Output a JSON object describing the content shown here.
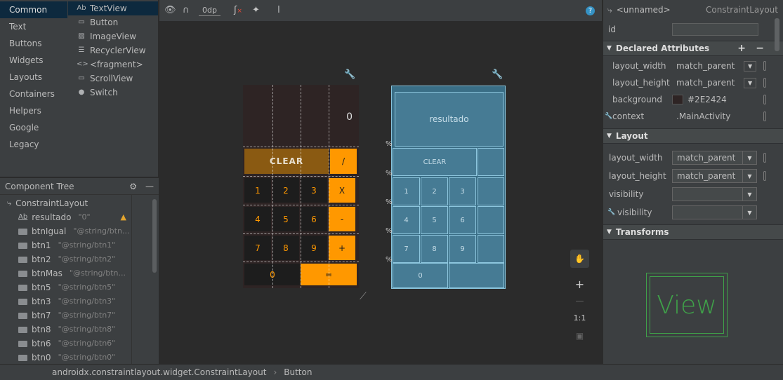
{
  "palette": {
    "categories": [
      "Common",
      "Text",
      "Buttons",
      "Widgets",
      "Layouts",
      "Containers",
      "Helpers",
      "Google",
      "Legacy"
    ],
    "selected_category": "Common",
    "widgets": [
      {
        "icon": "Ab",
        "label": "TextView"
      },
      {
        "icon": "▭",
        "label": "Button"
      },
      {
        "icon": "▨",
        "label": "ImageView"
      },
      {
        "icon": "☰",
        "label": "RecyclerView"
      },
      {
        "icon": "<>",
        "label": "<fragment>"
      },
      {
        "icon": "▭",
        "label": "ScrollView"
      },
      {
        "icon": "●",
        "label": "Switch"
      }
    ]
  },
  "component_tree": {
    "title": "Component Tree",
    "root": "ConstraintLayout",
    "nodes": [
      {
        "name": "resultado",
        "value": "\"0\"",
        "warning": true,
        "text_icon": true
      },
      {
        "name": "btnIgual",
        "value": "\"@string/btn..."
      },
      {
        "name": "btn1",
        "value": "\"@string/btn1\""
      },
      {
        "name": "btn2",
        "value": "\"@string/btn2\""
      },
      {
        "name": "btnMas",
        "value": "\"@string/btn..."
      },
      {
        "name": "btn5",
        "value": "\"@string/btn5\""
      },
      {
        "name": "btn3",
        "value": "\"@string/btn3\""
      },
      {
        "name": "btn7",
        "value": "\"@string/btn7\""
      },
      {
        "name": "btn8",
        "value": "\"@string/btn8\""
      },
      {
        "name": "btn6",
        "value": "\"@string/btn6\""
      },
      {
        "name": "btn0",
        "value": "\"@string/btn0\""
      }
    ]
  },
  "toolbar": {
    "default_margin": "0dp",
    "help": "?"
  },
  "design": {
    "result_text": "0",
    "clear_label": "CLEAR",
    "rows": [
      [
        "1",
        "2",
        "3",
        "X"
      ],
      [
        "4",
        "5",
        "6",
        "-"
      ],
      [
        "7",
        "8",
        "9",
        "+"
      ]
    ],
    "div_label": "/",
    "zero_label": "0",
    "equals_label": "="
  },
  "blueprint": {
    "result_label": "resultado",
    "clear_label": "CLEAR",
    "rows": [
      [
        "1",
        "2",
        "3"
      ],
      [
        "4",
        "5",
        "6"
      ],
      [
        "7",
        "8",
        "9"
      ]
    ],
    "zero_label": "0",
    "percent_mark": "%"
  },
  "zoom": {
    "pan_icon": "hand-icon",
    "zoom_in": "+",
    "zoom_out": "—",
    "ratio": "1:1"
  },
  "attributes": {
    "header_name": "<unnamed>",
    "header_class": "ConstraintLayout",
    "id_label": "id",
    "declared_title": "Declared Attributes",
    "declared": [
      {
        "key": "layout_width",
        "value": "match_parent",
        "dropdown": true
      },
      {
        "key": "layout_height",
        "value": "match_parent",
        "dropdown": true
      },
      {
        "key": "background",
        "value": "#2E2424",
        "swatch": "#2E2424"
      },
      {
        "key": "context",
        "value": ".MainActivity"
      }
    ],
    "layout_title": "Layout",
    "layout": [
      {
        "key": "layout_width",
        "value": "match_parent"
      },
      {
        "key": "layout_height",
        "value": "match_parent"
      },
      {
        "key": "visibility",
        "value": ""
      },
      {
        "key": "visibility",
        "value": ""
      }
    ],
    "transforms_title": "Transforms",
    "preview_label": "View"
  },
  "status": {
    "path": "androidx.constraintlayout.widget.ConstraintLayout",
    "separator": "›",
    "current": "Button"
  },
  "colors": {
    "accent_orange": "#FF9800",
    "clear_brown": "#8A5A12",
    "phone_bg": "#2E2424",
    "blueprint": "#3A6E86",
    "view_green": "#3FA149",
    "warning": "#E2A42E"
  }
}
